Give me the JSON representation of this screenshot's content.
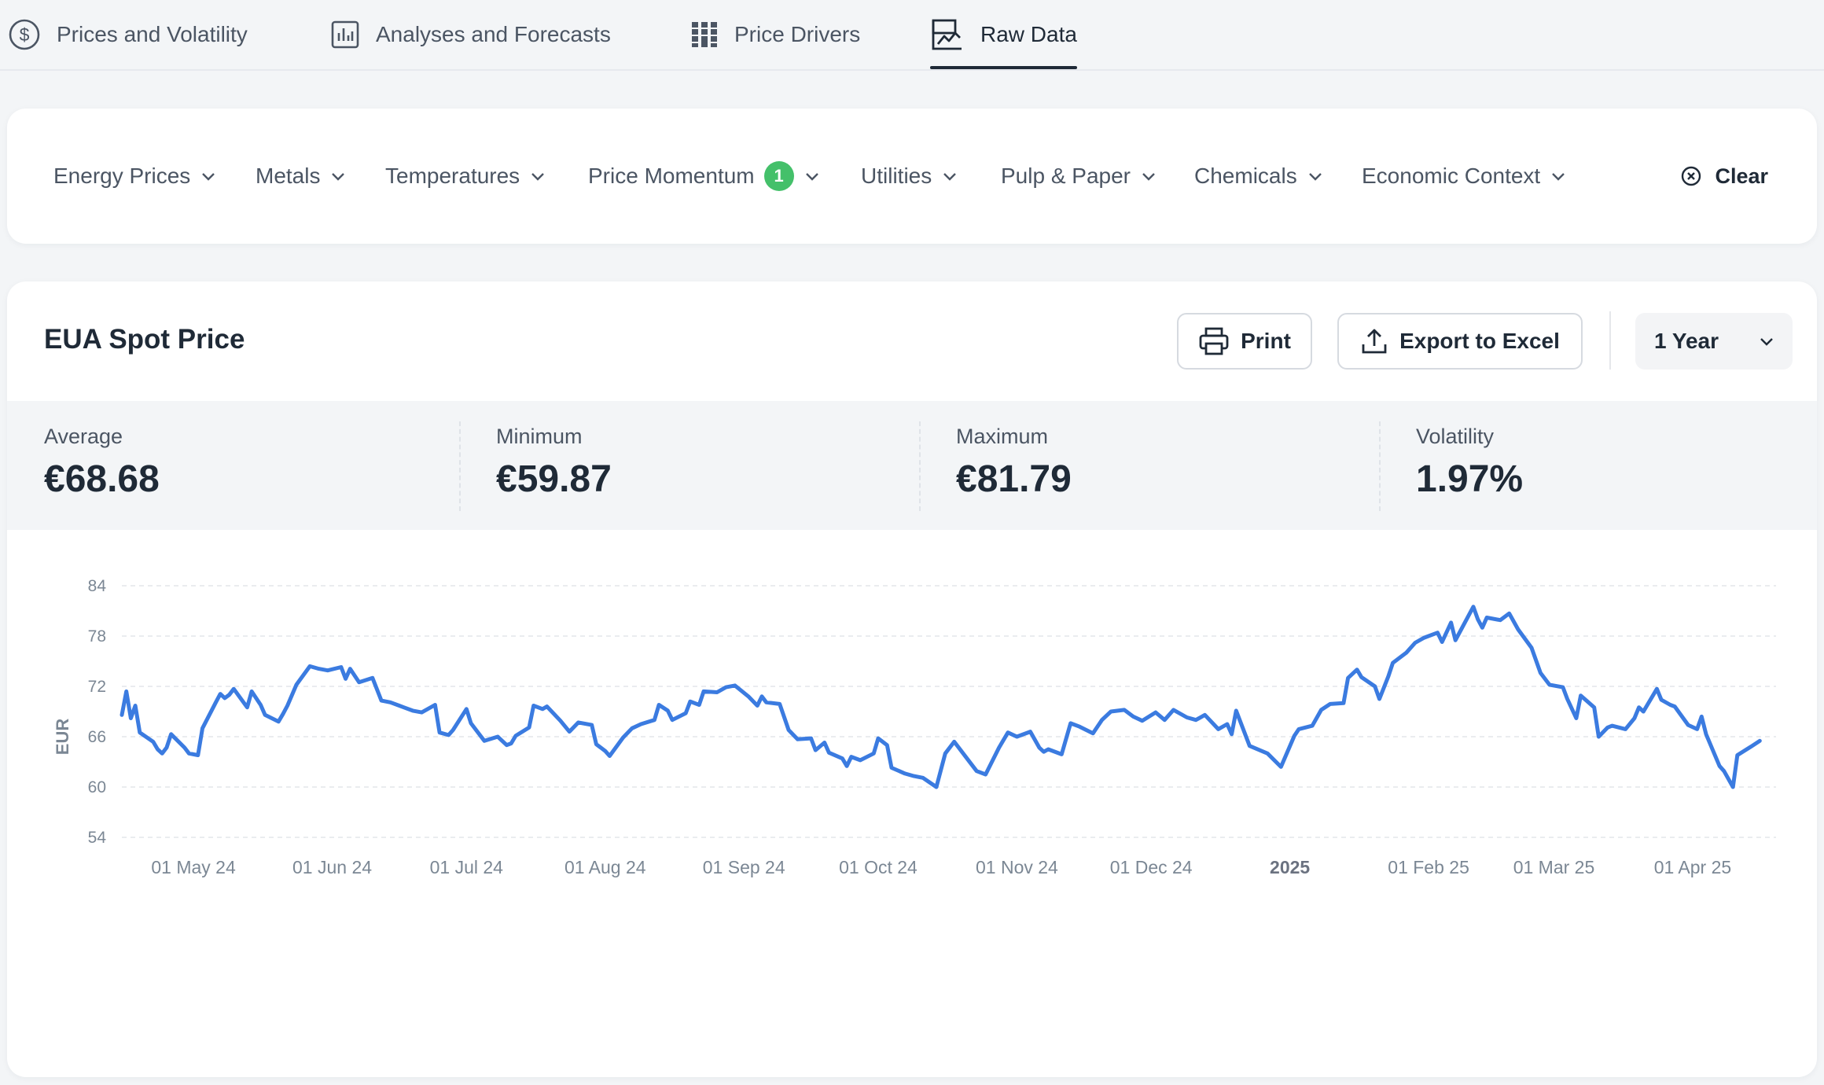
{
  "tabs": [
    {
      "label": "Prices and Volatility",
      "icon": "dollar-circle-icon",
      "active": false
    },
    {
      "label": "Analyses and Forecasts",
      "icon": "bar-chart-icon",
      "active": false
    },
    {
      "label": "Price Drivers",
      "icon": "grid-bars-icon",
      "active": false
    },
    {
      "label": "Raw Data",
      "icon": "line-chart-icon",
      "active": true
    }
  ],
  "filters": [
    {
      "label": "Energy Prices"
    },
    {
      "label": "Metals"
    },
    {
      "label": "Temperatures"
    },
    {
      "label": "Price Momentum",
      "badge": "1"
    },
    {
      "label": "Utilities"
    },
    {
      "label": "Pulp & Paper"
    },
    {
      "label": "Chemicals"
    },
    {
      "label": "Economic Context"
    }
  ],
  "clear_label": "Clear",
  "card": {
    "title": "EUA Spot Price",
    "print_label": "Print",
    "export_label": "Export to Excel",
    "range_selected": "1 Year"
  },
  "stats": [
    {
      "label": "Average",
      "value": "€68.68"
    },
    {
      "label": "Minimum",
      "value": "€59.87"
    },
    {
      "label": "Maximum",
      "value": "€81.79"
    },
    {
      "label": "Volatility",
      "value": "1.97%"
    }
  ],
  "colors": {
    "line": "#3b7be0",
    "badge": "#44c06a",
    "text_dark": "#1f2a37",
    "text_muted": "#4b5563"
  },
  "chart_data": {
    "type": "line",
    "title": "",
    "xlabel": "",
    "ylabel": "EUR",
    "ylim": [
      54,
      84
    ],
    "yticks": [
      84,
      78,
      72,
      66,
      60,
      54
    ],
    "grid": true,
    "x_tick_labels": [
      "01 May 24",
      "01 Jun 24",
      "01 Jul 24",
      "01 Aug 24",
      "01 Sep 24",
      "01 Oct 24",
      "01 Nov 24",
      "01 Dec 24",
      "2025",
      "01 Feb 25",
      "01 Mar 25",
      "01 Apr 25"
    ],
    "x_tick_dates": [
      "2024-05-01",
      "2024-06-01",
      "2024-07-01",
      "2024-08-01",
      "2024-09-01",
      "2024-10-01",
      "2024-11-01",
      "2024-12-01",
      "2025-01-01",
      "2025-02-01",
      "2025-03-01",
      "2025-04-01"
    ],
    "x_range": [
      "2024-04-15",
      "2025-04-17"
    ],
    "series": [
      {
        "values": [
          [
            "2024-04-15",
            68.6
          ],
          [
            "2024-04-16",
            71.4
          ],
          [
            "2024-04-17",
            68.2
          ],
          [
            "2024-04-18",
            69.7
          ],
          [
            "2024-04-19",
            66.5
          ],
          [
            "2024-04-22",
            65.4
          ],
          [
            "2024-04-23",
            64.5
          ],
          [
            "2024-04-24",
            64.0
          ],
          [
            "2024-04-25",
            64.7
          ],
          [
            "2024-04-26",
            66.3
          ],
          [
            "2024-04-29",
            64.7
          ],
          [
            "2024-04-30",
            64.0
          ],
          [
            "2024-05-02",
            63.8
          ],
          [
            "2024-05-03",
            67.0
          ],
          [
            "2024-05-06",
            70.1
          ],
          [
            "2024-05-07",
            71.1
          ],
          [
            "2024-05-08",
            70.6
          ],
          [
            "2024-05-09",
            71.0
          ],
          [
            "2024-05-10",
            71.7
          ],
          [
            "2024-05-13",
            69.5
          ],
          [
            "2024-05-14",
            71.4
          ],
          [
            "2024-05-16",
            69.8
          ],
          [
            "2024-05-17",
            68.6
          ],
          [
            "2024-05-20",
            67.8
          ],
          [
            "2024-05-21",
            68.7
          ],
          [
            "2024-05-22",
            69.7
          ],
          [
            "2024-05-24",
            72.2
          ],
          [
            "2024-05-27",
            74.4
          ],
          [
            "2024-05-29",
            74.1
          ],
          [
            "2024-05-31",
            73.9
          ],
          [
            "2024-06-03",
            74.3
          ],
          [
            "2024-06-04",
            72.9
          ],
          [
            "2024-06-05",
            74.1
          ],
          [
            "2024-06-07",
            72.5
          ],
          [
            "2024-06-10",
            73.0
          ],
          [
            "2024-06-12",
            70.3
          ],
          [
            "2024-06-14",
            70.1
          ],
          [
            "2024-06-17",
            69.5
          ],
          [
            "2024-06-19",
            69.1
          ],
          [
            "2024-06-21",
            68.9
          ],
          [
            "2024-06-24",
            69.8
          ],
          [
            "2024-06-25",
            66.5
          ],
          [
            "2024-06-27",
            66.2
          ],
          [
            "2024-06-28",
            66.8
          ],
          [
            "2024-07-01",
            69.3
          ],
          [
            "2024-07-02",
            67.6
          ],
          [
            "2024-07-04",
            66.2
          ],
          [
            "2024-07-05",
            65.5
          ],
          [
            "2024-07-08",
            66.0
          ],
          [
            "2024-07-10",
            65.0
          ],
          [
            "2024-07-11",
            65.2
          ],
          [
            "2024-07-12",
            66.1
          ],
          [
            "2024-07-15",
            67.1
          ],
          [
            "2024-07-16",
            69.7
          ],
          [
            "2024-07-18",
            69.3
          ],
          [
            "2024-07-19",
            69.6
          ],
          [
            "2024-07-22",
            67.9
          ],
          [
            "2024-07-24",
            66.6
          ],
          [
            "2024-07-26",
            67.7
          ],
          [
            "2024-07-29",
            67.4
          ],
          [
            "2024-07-30",
            65.1
          ],
          [
            "2024-08-01",
            64.3
          ],
          [
            "2024-08-02",
            63.7
          ],
          [
            "2024-08-05",
            65.9
          ],
          [
            "2024-08-07",
            67.0
          ],
          [
            "2024-08-09",
            67.5
          ],
          [
            "2024-08-12",
            68.0
          ],
          [
            "2024-08-13",
            69.8
          ],
          [
            "2024-08-15",
            69.1
          ],
          [
            "2024-08-16",
            68.0
          ],
          [
            "2024-08-19",
            68.8
          ],
          [
            "2024-08-20",
            70.2
          ],
          [
            "2024-08-22",
            69.8
          ],
          [
            "2024-08-23",
            71.4
          ],
          [
            "2024-08-26",
            71.3
          ],
          [
            "2024-08-28",
            71.9
          ],
          [
            "2024-08-30",
            72.1
          ],
          [
            "2024-09-02",
            70.8
          ],
          [
            "2024-09-04",
            69.7
          ],
          [
            "2024-09-05",
            70.8
          ],
          [
            "2024-09-06",
            70.1
          ],
          [
            "2024-09-09",
            69.9
          ],
          [
            "2024-09-11",
            66.8
          ],
          [
            "2024-09-13",
            65.7
          ],
          [
            "2024-09-16",
            65.8
          ],
          [
            "2024-09-17",
            64.4
          ],
          [
            "2024-09-19",
            65.3
          ],
          [
            "2024-09-20",
            64.1
          ],
          [
            "2024-09-23",
            63.4
          ],
          [
            "2024-09-24",
            62.5
          ],
          [
            "2024-09-25",
            63.6
          ],
          [
            "2024-09-27",
            63.2
          ],
          [
            "2024-09-30",
            64.0
          ],
          [
            "2024-10-01",
            65.8
          ],
          [
            "2024-10-03",
            65.0
          ],
          [
            "2024-10-04",
            62.3
          ],
          [
            "2024-10-07",
            61.6
          ],
          [
            "2024-10-09",
            61.3
          ],
          [
            "2024-10-11",
            61.1
          ],
          [
            "2024-10-14",
            60.0
          ],
          [
            "2024-10-16",
            64.0
          ],
          [
            "2024-10-18",
            65.4
          ],
          [
            "2024-10-21",
            63.3
          ],
          [
            "2024-10-23",
            61.9
          ],
          [
            "2024-10-25",
            61.5
          ],
          [
            "2024-10-28",
            64.7
          ],
          [
            "2024-10-30",
            66.5
          ],
          [
            "2024-11-01",
            66.0
          ],
          [
            "2024-11-04",
            66.6
          ],
          [
            "2024-11-06",
            64.7
          ],
          [
            "2024-11-07",
            64.2
          ],
          [
            "2024-11-08",
            64.5
          ],
          [
            "2024-11-11",
            63.9
          ],
          [
            "2024-11-13",
            67.6
          ],
          [
            "2024-11-15",
            67.2
          ],
          [
            "2024-11-18",
            66.4
          ],
          [
            "2024-11-20",
            68.0
          ],
          [
            "2024-11-22",
            69.0
          ],
          [
            "2024-11-25",
            69.2
          ],
          [
            "2024-11-27",
            68.4
          ],
          [
            "2024-11-29",
            67.9
          ],
          [
            "2024-12-02",
            68.9
          ],
          [
            "2024-12-04",
            68.0
          ],
          [
            "2024-12-06",
            69.2
          ],
          [
            "2024-12-09",
            68.3
          ],
          [
            "2024-12-11",
            68.0
          ],
          [
            "2024-12-13",
            68.6
          ],
          [
            "2024-12-16",
            66.9
          ],
          [
            "2024-12-18",
            67.5
          ],
          [
            "2024-12-19",
            66.3
          ],
          [
            "2024-12-20",
            69.1
          ],
          [
            "2024-12-23",
            64.9
          ],
          [
            "2024-12-27",
            64.0
          ],
          [
            "2024-12-30",
            62.4
          ],
          [
            "2025-01-02",
            66.1
          ],
          [
            "2025-01-03",
            66.9
          ],
          [
            "2025-01-06",
            67.3
          ],
          [
            "2025-01-08",
            69.2
          ],
          [
            "2025-01-10",
            69.9
          ],
          [
            "2025-01-13",
            70.0
          ],
          [
            "2025-01-14",
            73.0
          ],
          [
            "2025-01-16",
            74.0
          ],
          [
            "2025-01-17",
            73.1
          ],
          [
            "2025-01-20",
            72.0
          ],
          [
            "2025-01-21",
            70.5
          ],
          [
            "2025-01-23",
            73.2
          ],
          [
            "2025-01-24",
            74.8
          ],
          [
            "2025-01-27",
            76.0
          ],
          [
            "2025-01-29",
            77.2
          ],
          [
            "2025-01-31",
            77.8
          ],
          [
            "2025-02-03",
            78.4
          ],
          [
            "2025-02-04",
            77.3
          ],
          [
            "2025-02-06",
            79.6
          ],
          [
            "2025-02-07",
            77.5
          ],
          [
            "2025-02-10",
            80.5
          ],
          [
            "2025-02-11",
            81.5
          ],
          [
            "2025-02-12",
            80.0
          ],
          [
            "2025-02-13",
            79.0
          ],
          [
            "2025-02-14",
            80.2
          ],
          [
            "2025-02-17",
            79.9
          ],
          [
            "2025-02-19",
            80.7
          ],
          [
            "2025-02-21",
            78.8
          ],
          [
            "2025-02-24",
            76.6
          ],
          [
            "2025-02-26",
            73.6
          ],
          [
            "2025-02-28",
            72.2
          ],
          [
            "2025-03-03",
            71.9
          ],
          [
            "2025-03-04",
            70.5
          ],
          [
            "2025-03-06",
            68.2
          ],
          [
            "2025-03-07",
            70.9
          ],
          [
            "2025-03-10",
            69.5
          ],
          [
            "2025-03-11",
            66.0
          ],
          [
            "2025-03-13",
            67.1
          ],
          [
            "2025-03-14",
            67.3
          ],
          [
            "2025-03-17",
            66.9
          ],
          [
            "2025-03-19",
            68.2
          ],
          [
            "2025-03-20",
            69.5
          ],
          [
            "2025-03-21",
            69.0
          ],
          [
            "2025-03-24",
            71.7
          ],
          [
            "2025-03-25",
            70.4
          ],
          [
            "2025-03-27",
            69.8
          ],
          [
            "2025-03-28",
            69.6
          ],
          [
            "2025-03-31",
            67.4
          ],
          [
            "2025-04-02",
            66.9
          ],
          [
            "2025-04-03",
            68.4
          ],
          [
            "2025-04-04",
            66.3
          ],
          [
            "2025-04-07",
            62.5
          ],
          [
            "2025-04-08",
            61.9
          ],
          [
            "2025-04-10",
            60.0
          ],
          [
            "2025-04-11",
            63.8
          ],
          [
            "2025-04-14",
            64.8
          ],
          [
            "2025-04-16",
            65.5
          ]
        ]
      }
    ]
  }
}
